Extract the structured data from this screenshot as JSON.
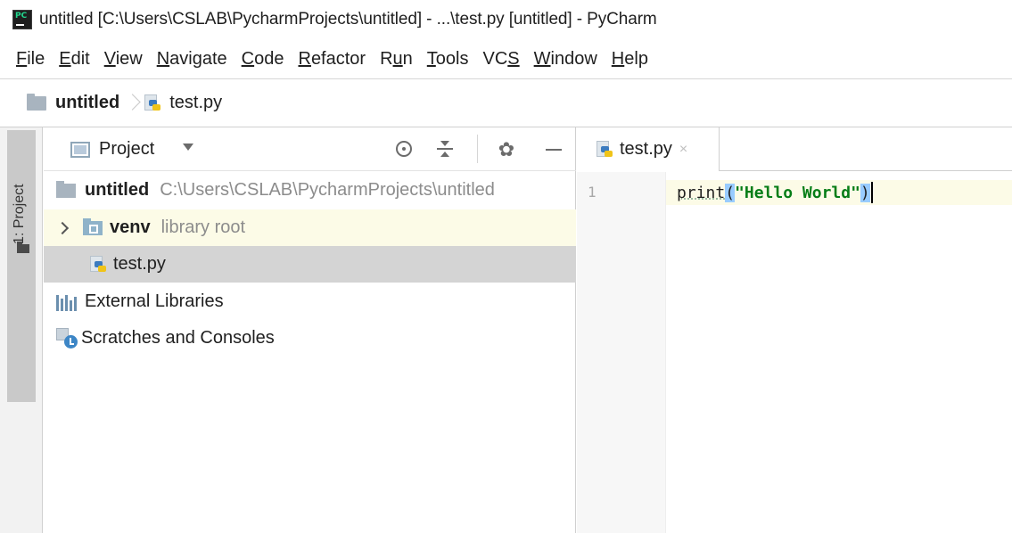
{
  "window": {
    "title": "untitled [C:\\Users\\CSLAB\\PycharmProjects\\untitled] - ...\\test.py [untitled] - PyCharm",
    "logo_text": "PC"
  },
  "menu": {
    "items": [
      {
        "mnemonic": "F",
        "rest": "ile"
      },
      {
        "mnemonic": "E",
        "rest": "dit"
      },
      {
        "mnemonic": "V",
        "rest": "iew"
      },
      {
        "mnemonic": "N",
        "rest": "avigate"
      },
      {
        "mnemonic": "C",
        "rest": "ode"
      },
      {
        "mnemonic": "R",
        "rest": "efactor"
      },
      {
        "pre": "R",
        "mnemonic": "u",
        "rest": "n"
      },
      {
        "mnemonic": "T",
        "rest": "ools"
      },
      {
        "pre": "VC",
        "mnemonic": "S",
        "rest": ""
      },
      {
        "mnemonic": "W",
        "rest": "indow"
      },
      {
        "mnemonic": "H",
        "rest": "elp"
      }
    ]
  },
  "breadcrumb": {
    "project": "untitled",
    "file": "test.py"
  },
  "tool_stripe": {
    "project_tab": "1: Project"
  },
  "project_panel": {
    "title": "Project",
    "gear_glyph": "✿",
    "tree": {
      "root_name": "untitled",
      "root_path": "C:\\Users\\CSLAB\\PycharmProjects\\untitled",
      "venv_name": "venv",
      "venv_note": "library root",
      "file_name": "test.py",
      "external_libraries": "External Libraries",
      "scratches": "Scratches and Consoles"
    }
  },
  "editor": {
    "tab_label": "test.py",
    "tab_close": "×",
    "line_number": "1",
    "code": {
      "func": "print",
      "open_paren": "(",
      "string": "\"Hello World\"",
      "close_paren": ")"
    }
  },
  "colors": {
    "venv_row_bg": "#fcfbe7",
    "selected_row_bg": "#d4d4d4",
    "string_green": "#067d17",
    "paren_match": "#99ccff"
  }
}
